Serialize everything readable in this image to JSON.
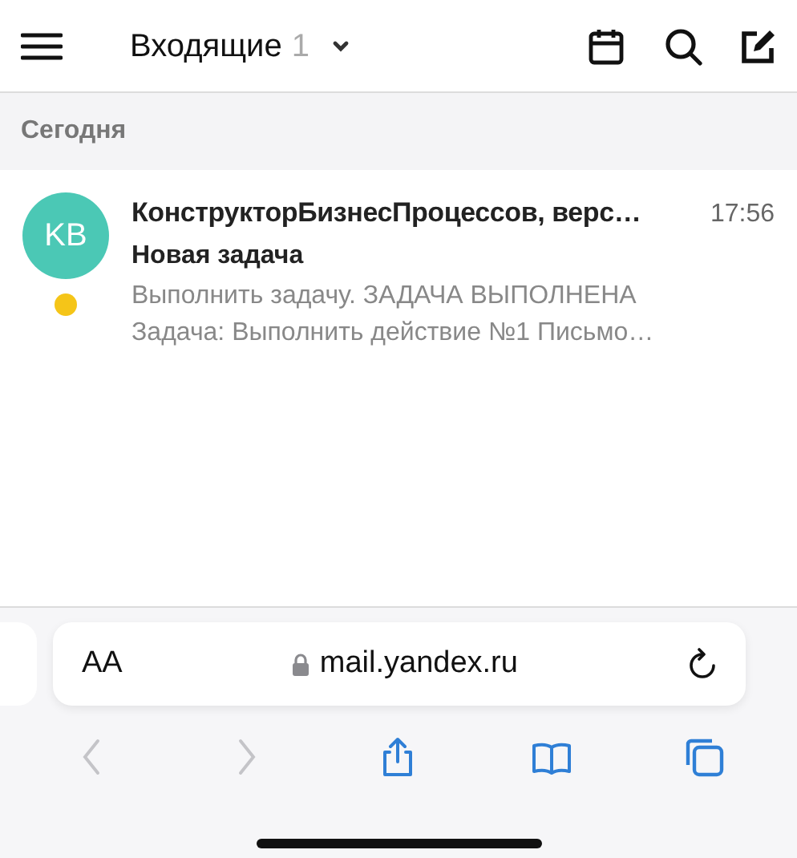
{
  "header": {
    "title": "Входящие",
    "count": "1"
  },
  "section": {
    "title": "Сегодня"
  },
  "messages": [
    {
      "initials": "KB",
      "color": "#4bc8b5",
      "sender": "КонструкторБизнесПроцессов, верс…",
      "time": "17:56",
      "subject": "Новая задача",
      "preview": "Выполнить задачу. ЗАДАЧА ВЫПОЛНЕНА Задача: Выполнить действие №1 Письмо…",
      "unread": true
    }
  ],
  "browser": {
    "text_size": "AA",
    "address": "mail.yandex.ru"
  },
  "toolbar": [
    {
      "kind": "back",
      "disabled": true
    },
    {
      "kind": "forward",
      "disabled": true
    },
    {
      "kind": "share",
      "disabled": false
    },
    {
      "kind": "bookmarks",
      "disabled": false
    },
    {
      "kind": "tabs",
      "disabled": false
    }
  ]
}
